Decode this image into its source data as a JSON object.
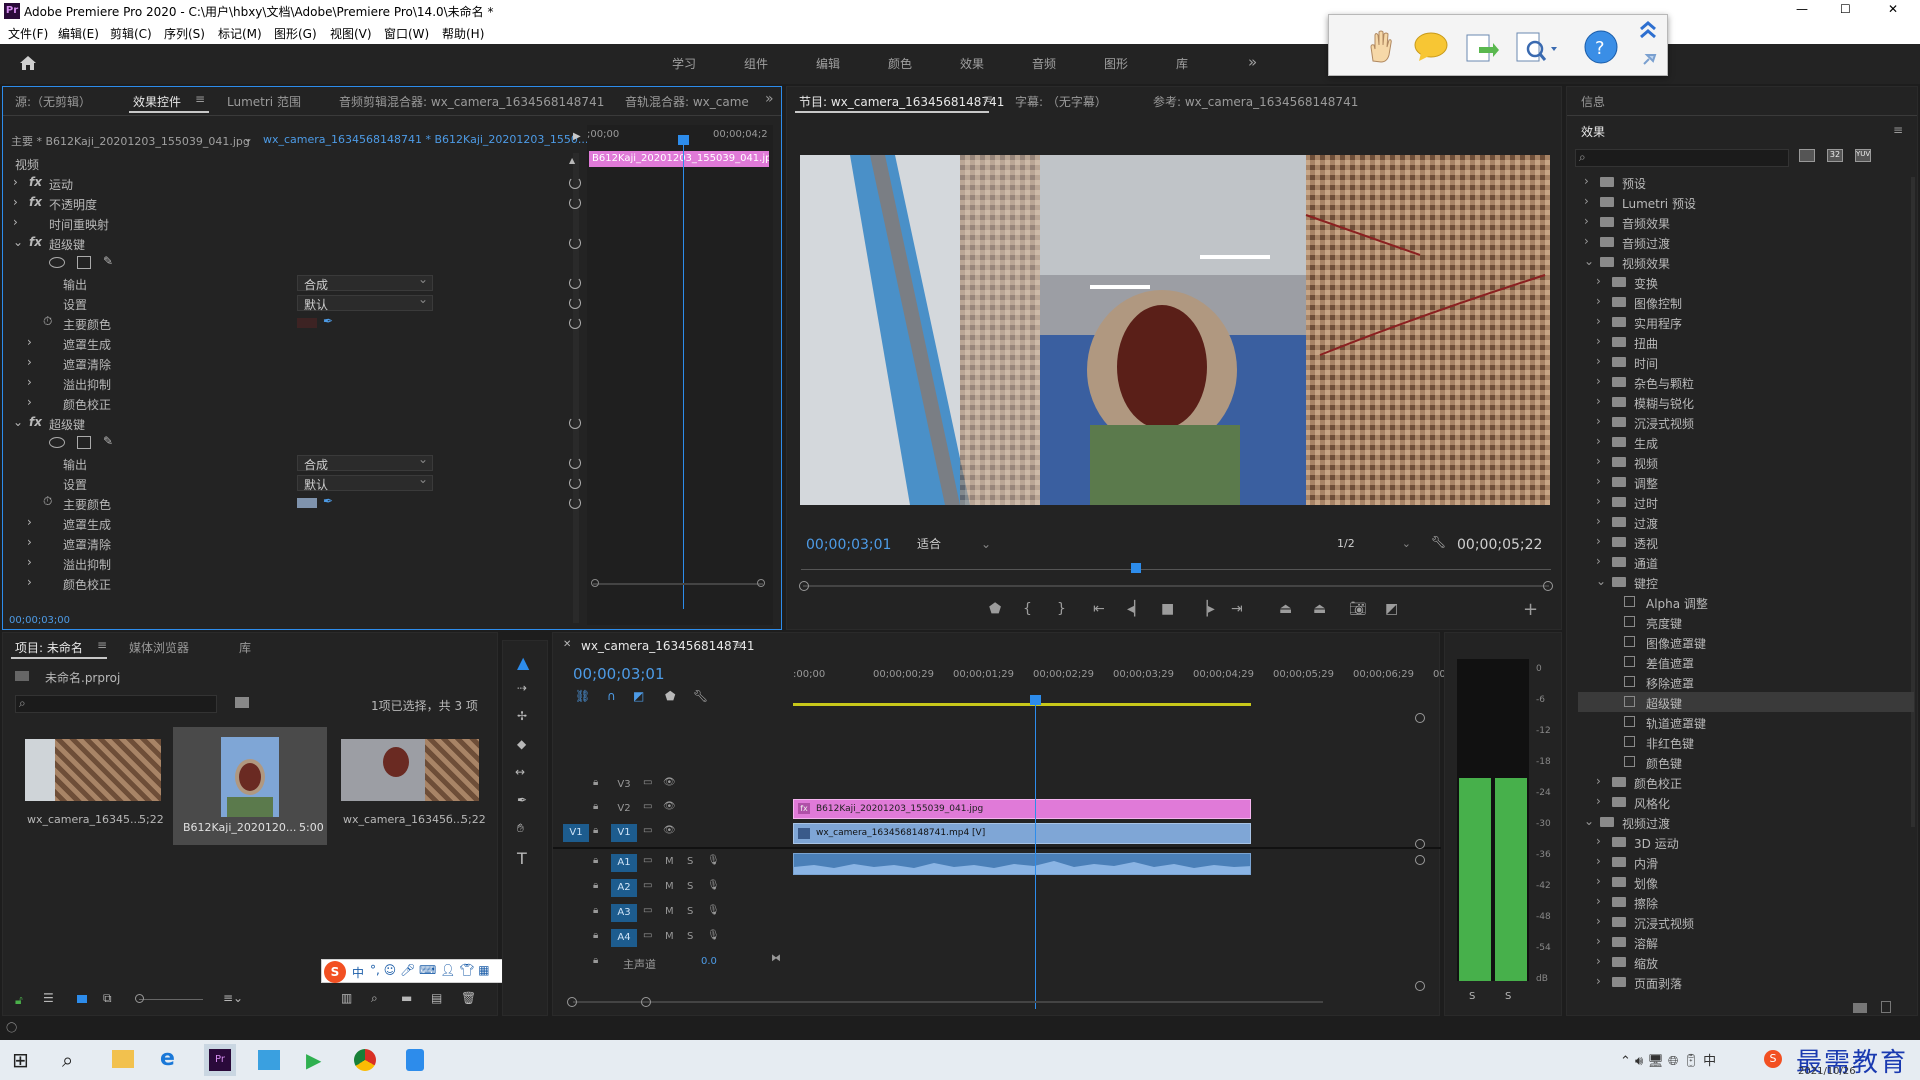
{
  "app": {
    "title": "Adobe Premiere Pro 2020 - C:\\用户\\hbxy\\文档\\Adobe\\Premiere Pro\\14.0\\未命名 *",
    "logo": "Pr",
    "window_controls": [
      "—",
      "☐",
      "✕"
    ]
  },
  "menu": [
    "文件(F)",
    "编辑(E)",
    "剪辑(C)",
    "序列(S)",
    "标记(M)",
    "图形(G)",
    "视图(V)",
    "窗口(W)",
    "帮助(H)"
  ],
  "workspaces": [
    "学习",
    "组件",
    "编辑",
    "颜色",
    "效果",
    "音频",
    "图形",
    "库",
    "»"
  ],
  "effect_controls": {
    "tabs": [
      "源:（无剪辑）",
      "效果控件",
      "Lumetri 范围",
      "音频剪辑混合器: wx_camera_1634568148741",
      "音轨混合器: wx_came"
    ],
    "master_label": "主要 * B612Kaji_20201203_155039_041.jpg",
    "sequence_label": "wx_camera_1634568148741 * B612Kaji_20201203_1550...",
    "ruler_start": ";00;00",
    "ruler_end": "00;00;04;2",
    "clip_label": "B612Kaji_20201203_155039_041.jpg",
    "video_header": "视频",
    "props": [
      "运动",
      "不透明度",
      "时间重映射"
    ],
    "ultra_key_1": {
      "name": "超级键",
      "output_label": "输出",
      "output_value": "合成",
      "setting_label": "设置",
      "setting_value": "默认",
      "key_color_label": "主要颜色",
      "key_color": "#3d2323",
      "groups": [
        "遮罩生成",
        "遮罩清除",
        "溢出抑制",
        "颜色校正"
      ]
    },
    "ultra_key_2": {
      "name": "超级键",
      "output_label": "输出",
      "output_value": "合成",
      "setting_label": "设置",
      "setting_value": "默认",
      "key_color_label": "主要颜色",
      "key_color": "#7f93ad",
      "groups": [
        "遮罩生成",
        "遮罩清除",
        "溢出抑制",
        "颜色校正"
      ]
    },
    "timecode": "00;00;03;00"
  },
  "program": {
    "tabs": [
      "节目: wx_camera_1634568148741",
      "字幕: （无字幕）",
      "参考: wx_camera_1634568148741"
    ],
    "timecode": "00;00;03;01",
    "fit": "适合",
    "resolution": "1/2",
    "duration": "00;00;05;22",
    "playhead_progress": 0.55
  },
  "info_effects": {
    "info_tab": "信息",
    "effects_tab": "效果",
    "tree": [
      {
        "label": "预设",
        "level": 0,
        "type": "folder",
        "open": false
      },
      {
        "label": "Lumetri 预设",
        "level": 0,
        "type": "folder",
        "open": false
      },
      {
        "label": "音频效果",
        "level": 0,
        "type": "folder",
        "open": false
      },
      {
        "label": "音频过渡",
        "level": 0,
        "type": "folder",
        "open": false
      },
      {
        "label": "视频效果",
        "level": 0,
        "type": "folder",
        "open": true
      },
      {
        "label": "变换",
        "level": 1,
        "type": "folder",
        "open": false
      },
      {
        "label": "图像控制",
        "level": 1,
        "type": "folder",
        "open": false
      },
      {
        "label": "实用程序",
        "level": 1,
        "type": "folder",
        "open": false
      },
      {
        "label": "扭曲",
        "level": 1,
        "type": "folder",
        "open": false
      },
      {
        "label": "时间",
        "level": 1,
        "type": "folder",
        "open": false
      },
      {
        "label": "杂色与颗粒",
        "level": 1,
        "type": "folder",
        "open": false
      },
      {
        "label": "模糊与锐化",
        "level": 1,
        "type": "folder",
        "open": false
      },
      {
        "label": "沉浸式视频",
        "level": 1,
        "type": "folder",
        "open": false
      },
      {
        "label": "生成",
        "level": 1,
        "type": "folder",
        "open": false
      },
      {
        "label": "视频",
        "level": 1,
        "type": "folder",
        "open": false
      },
      {
        "label": "调整",
        "level": 1,
        "type": "folder",
        "open": false
      },
      {
        "label": "过时",
        "level": 1,
        "type": "folder",
        "open": false
      },
      {
        "label": "过渡",
        "level": 1,
        "type": "folder",
        "open": false
      },
      {
        "label": "透视",
        "level": 1,
        "type": "folder",
        "open": false
      },
      {
        "label": "通道",
        "level": 1,
        "type": "folder",
        "open": false
      },
      {
        "label": "键控",
        "level": 1,
        "type": "folder",
        "open": true
      },
      {
        "label": "Alpha 调整",
        "level": 2,
        "type": "effect"
      },
      {
        "label": "亮度键",
        "level": 2,
        "type": "effect"
      },
      {
        "label": "图像遮罩键",
        "level": 2,
        "type": "effect"
      },
      {
        "label": "差值遮罩",
        "level": 2,
        "type": "effect"
      },
      {
        "label": "移除遮罩",
        "level": 2,
        "type": "effect"
      },
      {
        "label": "超级键",
        "level": 2,
        "type": "effect",
        "selected": true
      },
      {
        "label": "轨道遮罩键",
        "level": 2,
        "type": "effect"
      },
      {
        "label": "非红色键",
        "level": 2,
        "type": "effect"
      },
      {
        "label": "颜色键",
        "level": 2,
        "type": "effect"
      },
      {
        "label": "颜色校正",
        "level": 1,
        "type": "folder",
        "open": false
      },
      {
        "label": "风格化",
        "level": 1,
        "type": "folder",
        "open": false
      },
      {
        "label": "视频过渡",
        "level": 0,
        "type": "folder",
        "open": true
      },
      {
        "label": "3D 运动",
        "level": 1,
        "type": "folder",
        "open": false
      },
      {
        "label": "内滑",
        "level": 1,
        "type": "folder",
        "open": false
      },
      {
        "label": "划像",
        "level": 1,
        "type": "folder",
        "open": false
      },
      {
        "label": "擦除",
        "level": 1,
        "type": "folder",
        "open": false
      },
      {
        "label": "沉浸式视频",
        "level": 1,
        "type": "folder",
        "open": false
      },
      {
        "label": "溶解",
        "level": 1,
        "type": "folder",
        "open": false
      },
      {
        "label": "缩放",
        "level": 1,
        "type": "folder",
        "open": false
      },
      {
        "label": "页面剥落",
        "level": 1,
        "type": "folder",
        "open": false
      }
    ]
  },
  "project": {
    "tabs": [
      "项目: 未命名",
      "媒体浏览器",
      "库"
    ],
    "file": "未命名.prproj",
    "selection_info": "1项已选择，共 3 项",
    "items": [
      {
        "name": "wx_camera_16345...",
        "duration": "5;22"
      },
      {
        "name": "B612Kaji_2020120...",
        "duration": "5:00"
      },
      {
        "name": "wx_camera_16345б...",
        "duration": "5;22"
      }
    ],
    "ime_label": "中"
  },
  "timeline": {
    "tab": "wx_camera_1634568148741",
    "timecode": "00;00;03;01",
    "ruler": [
      ":00;00",
      "00;00;00;29",
      "00;00;01;29",
      "00;00;02;29",
      "00;00;03;29",
      "00;00;04;29",
      "00;00;05;29",
      "00;00;06;29",
      "00"
    ],
    "video_tracks": [
      "V3",
      "V2",
      "V1"
    ],
    "audio_tracks": [
      "A1",
      "A2",
      "A3",
      "A4"
    ],
    "master_label": "主声道",
    "master_value": "0.0",
    "clip_v2": "B612Kaji_20201203_155039_041.jpg",
    "clip_v1": "wx_camera_1634568148741.mp4 [V]",
    "source_patch_v": "V1",
    "m_label": "M",
    "s_label": "S"
  },
  "meter": {
    "scale": [
      "0",
      "-6",
      "-12",
      "-18",
      "-24",
      "-30",
      "-36",
      "-42",
      "-48",
      "-54",
      "dB"
    ],
    "level": 0.63,
    "solo_labels": [
      "S",
      "S"
    ]
  },
  "taskbar": {
    "date": "2021/10/26",
    "watermark": "最需教育"
  },
  "colors": {
    "accent": "#2d8ceb",
    "clip_pink": "#e07ad8",
    "clip_blue": "#7fa6d6",
    "meter_green": "#47b04b"
  }
}
